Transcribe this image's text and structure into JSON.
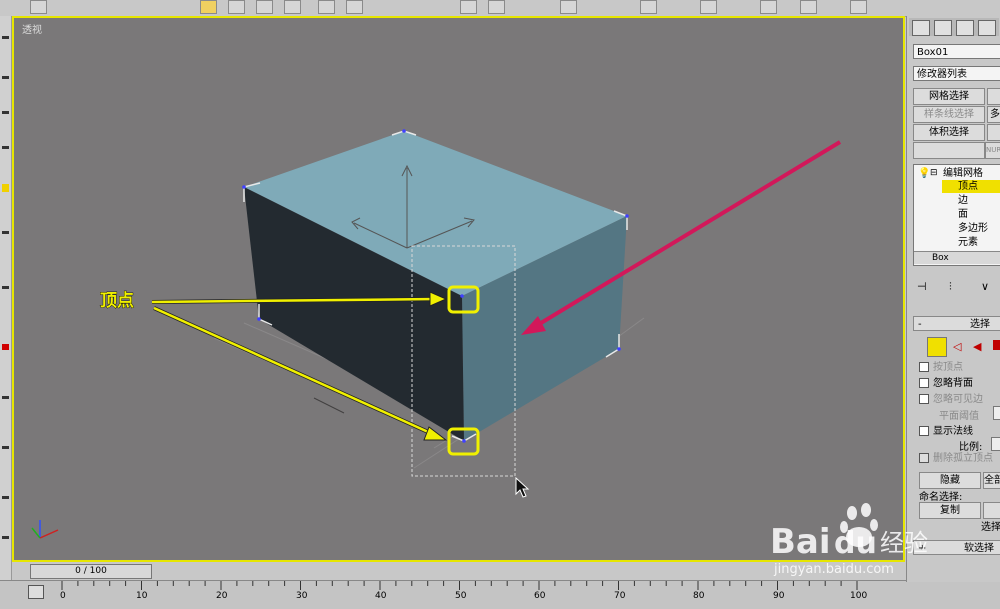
{
  "viewport": {
    "label": "透视"
  },
  "annotation": {
    "label": "顶点",
    "highlight_color": "#f0f000",
    "arrow_color": "#d2185a"
  },
  "timeline": {
    "slider_text": "0 / 100",
    "ticks": [
      "0",
      "10",
      "20",
      "30",
      "40",
      "50",
      "60",
      "70",
      "80",
      "90",
      "100"
    ]
  },
  "panel": {
    "object_name": "Box01",
    "modifier_list": "修改器列表",
    "buttons": {
      "mesh_select": "网格选择",
      "spline_select": "样条线选择",
      "volume_select": "体积选择",
      "partial_right_1": "多",
      "partial_nurbs": "NURE"
    },
    "stack": {
      "root": "编辑网格",
      "items": [
        "顶点",
        "边",
        "面",
        "多边形",
        "元素"
      ],
      "selected": "顶点",
      "base": "Box"
    },
    "selection_rollout": {
      "title": "选择",
      "options": [
        {
          "label": "按顶点",
          "enabled": false
        },
        {
          "label": "忽略背面",
          "enabled": true
        },
        {
          "label": "忽略可见边",
          "enabled": false
        }
      ],
      "planar_threshold": "平面阈值",
      "show_normals": "显示法线",
      "scale": "比例:",
      "delete_isolated": "删除孤立顶点",
      "hide": "隐藏",
      "all": "全部",
      "named_selection": "命名选择:",
      "copy": "复制",
      "select_partial": "选择",
      "soft_selection": "软选择"
    }
  },
  "watermark": {
    "brand": "Bai",
    "brand2": "du",
    "service": "经验",
    "url": "jingyan.baidu.com"
  },
  "colors": {
    "viewport_bg": "#7a7879",
    "box_top": "#7faab8",
    "box_side": "#547683",
    "box_front": "#232a30",
    "active_border": "#e6e600"
  }
}
